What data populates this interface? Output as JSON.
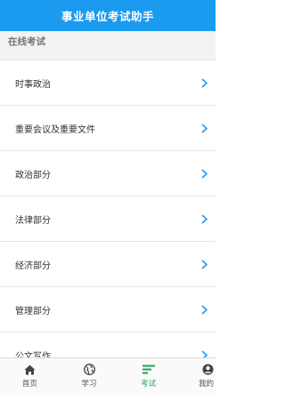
{
  "app": {
    "title": "事业单位考试助手"
  },
  "section": {
    "title": "在线考试"
  },
  "list": {
    "items": [
      {
        "label": "时事政治"
      },
      {
        "label": "重要会议及重要文件"
      },
      {
        "label": "政治部分"
      },
      {
        "label": "法律部分"
      },
      {
        "label": "经济部分"
      },
      {
        "label": "管理部分"
      },
      {
        "label": "公文写作"
      }
    ]
  },
  "tabs": [
    {
      "label": "首页",
      "icon": "home-icon"
    },
    {
      "label": "学习",
      "icon": "globe-icon"
    },
    {
      "label": "考试",
      "icon": "list-icon",
      "active": true
    },
    {
      "label": "我的",
      "icon": "user-icon"
    }
  ],
  "colors": {
    "accent": "#1a9bef",
    "active_tab": "#23a05a",
    "chevron": "#2196f3"
  }
}
